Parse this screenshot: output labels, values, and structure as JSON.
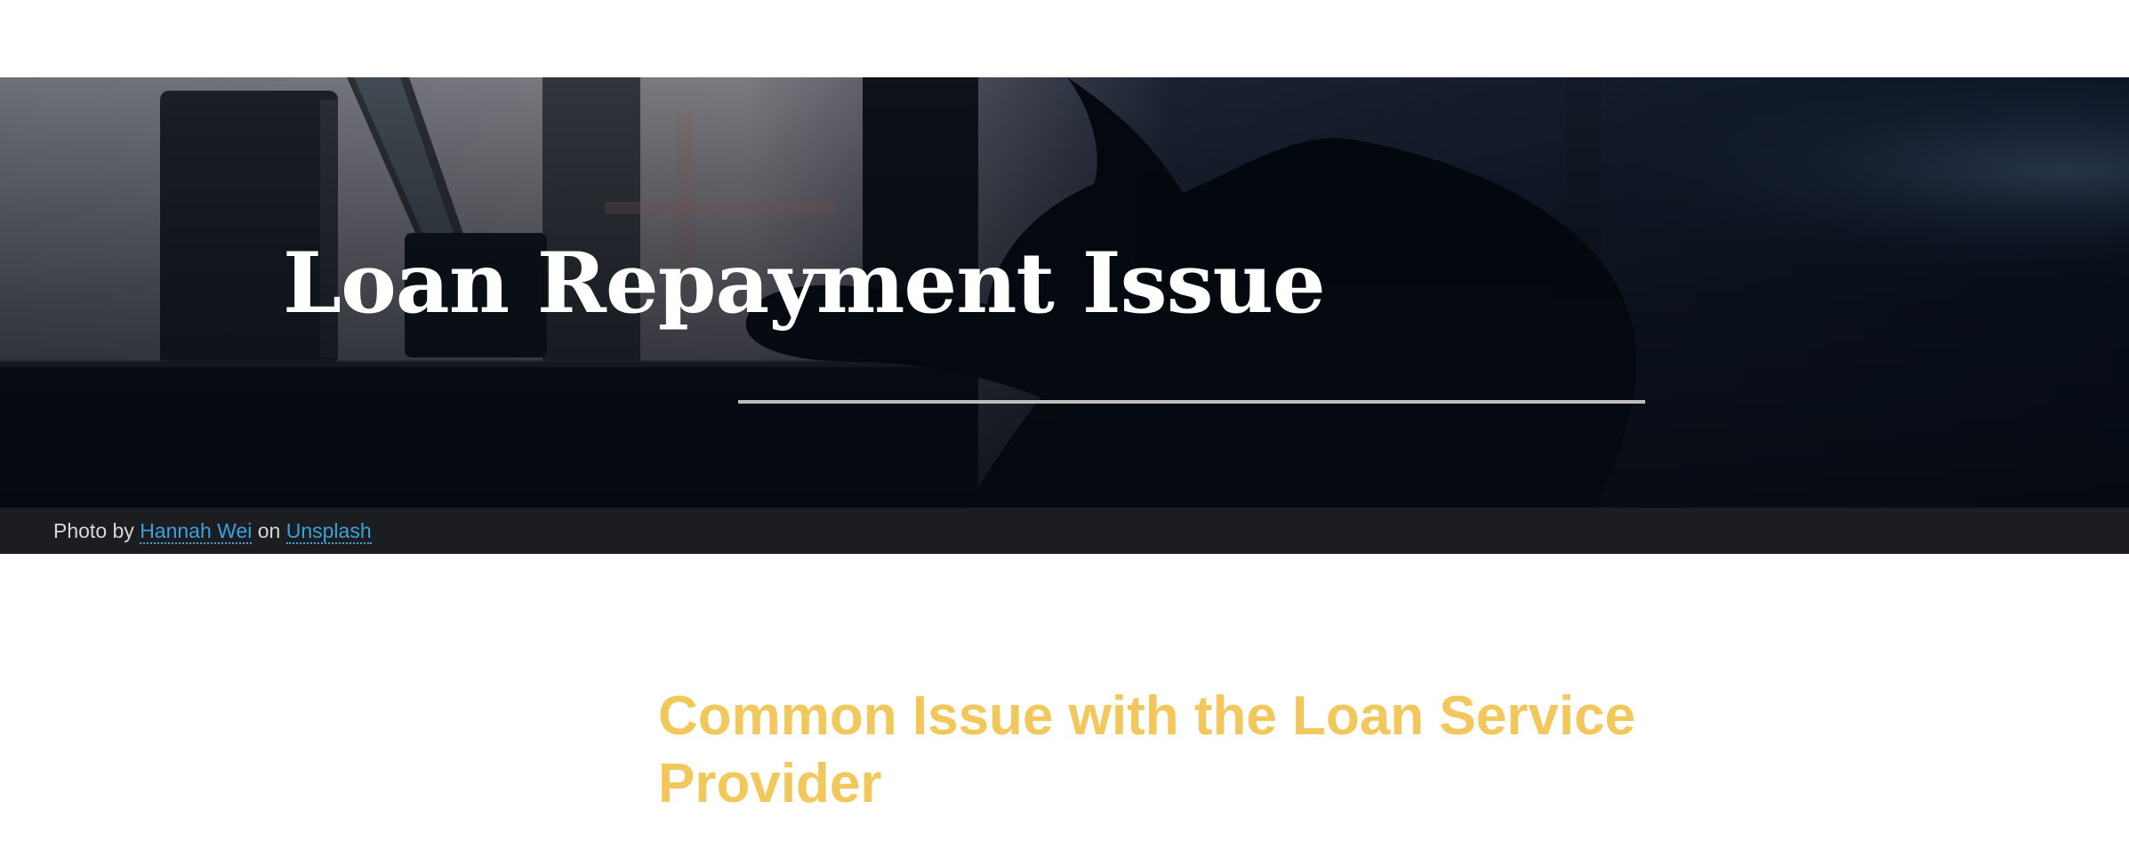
{
  "hero": {
    "title": "Loan Repayment Issue"
  },
  "photo_credit": {
    "prefix": "Photo by",
    "author": "Hannah Wei",
    "connector": "on",
    "source": "Unsplash"
  },
  "content": {
    "heading": "Common Issue with the Loan Service Provider"
  },
  "colors": {
    "heading_accent": "#f2c85c",
    "link": "#3aa2d8",
    "caption_bar": "#1e1f22"
  }
}
